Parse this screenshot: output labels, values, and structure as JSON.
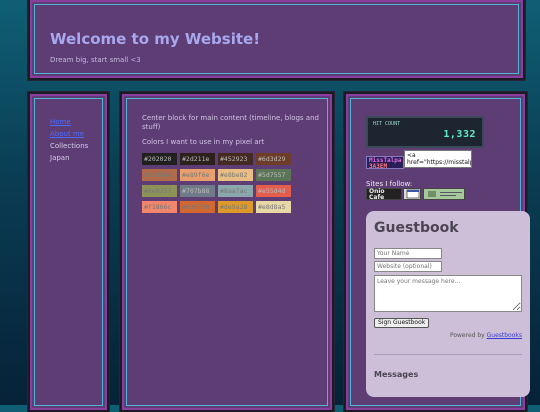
{
  "header": {
    "title": "Welcome to my Website!",
    "tagline": "Dream big, start small <3"
  },
  "nav": {
    "items": [
      {
        "label": "Home",
        "link": true
      },
      {
        "label": "About me",
        "link": true
      },
      {
        "label": "Collections",
        "link": false
      },
      {
        "label": "Japan",
        "link": false
      }
    ]
  },
  "main": {
    "intro": "Center block for main content (timeline, blogs and stuff)",
    "colors_label": "Colors I want to use in my pixel art",
    "swatches": [
      {
        "hex": "#202020",
        "text_color": "#bbbbbb"
      },
      {
        "hex": "#2d211e",
        "text_color": "#bbbbbb"
      },
      {
        "hex": "#452923",
        "text_color": "#bbbbbb"
      },
      {
        "hex": "#6d3d29",
        "text_color": "#bbbbbb"
      },
      {
        "hex": "#b16b4a",
        "text_color": "#777777"
      },
      {
        "hex": "#e89f6e",
        "text_color": "#777777"
      },
      {
        "hex": "#e8be82",
        "text_color": "#777777"
      },
      {
        "hex": "#5d7557",
        "text_color": "#bbbbbb"
      },
      {
        "hex": "#8e9257",
        "text_color": "#777777"
      },
      {
        "hex": "#707b88",
        "text_color": "#bbbbbb"
      },
      {
        "hex": "#8aa7ac",
        "text_color": "#777777"
      },
      {
        "hex": "#e55d4d",
        "text_color": "#bbbbbb"
      },
      {
        "hex": "#f1866c",
        "text_color": "#777777"
      },
      {
        "hex": "#d26730",
        "text_color": "#777777"
      },
      {
        "hex": "#de9a28",
        "text_color": "#777777"
      },
      {
        "hex": "#e8d8a5",
        "text_color": "#777777"
      }
    ]
  },
  "right": {
    "hitcount_label": "HIT COUNT",
    "hitcount_value": "1,332",
    "badge_line1": "MissTalpa",
    "badge_line2": "ЗАЗЕМ",
    "badge_alt_text": "<a href=\"https://misstalp",
    "follow_label": "Sites I follow:",
    "follow_buttons": [
      {
        "line1": "Onio",
        "line2": "Cafe",
        "bg": "#222222",
        "fg": "#f0f0f0"
      },
      {
        "line1": "",
        "line2": "",
        "bg": "#dadada",
        "fg": "#333333"
      },
      {
        "line1": "",
        "line2": "",
        "bg": "#a6c89a",
        "fg": "#333333"
      }
    ]
  },
  "guestbook": {
    "title": "Guestbook",
    "name_placeholder": "Your Name",
    "website_placeholder": "Website (optional)",
    "message_placeholder": "Leave your message here...",
    "sign_label": "Sign Guestbook",
    "powered_prefix": "Powered by ",
    "powered_link": "Guestbooks",
    "messages_heading": "Messages"
  }
}
